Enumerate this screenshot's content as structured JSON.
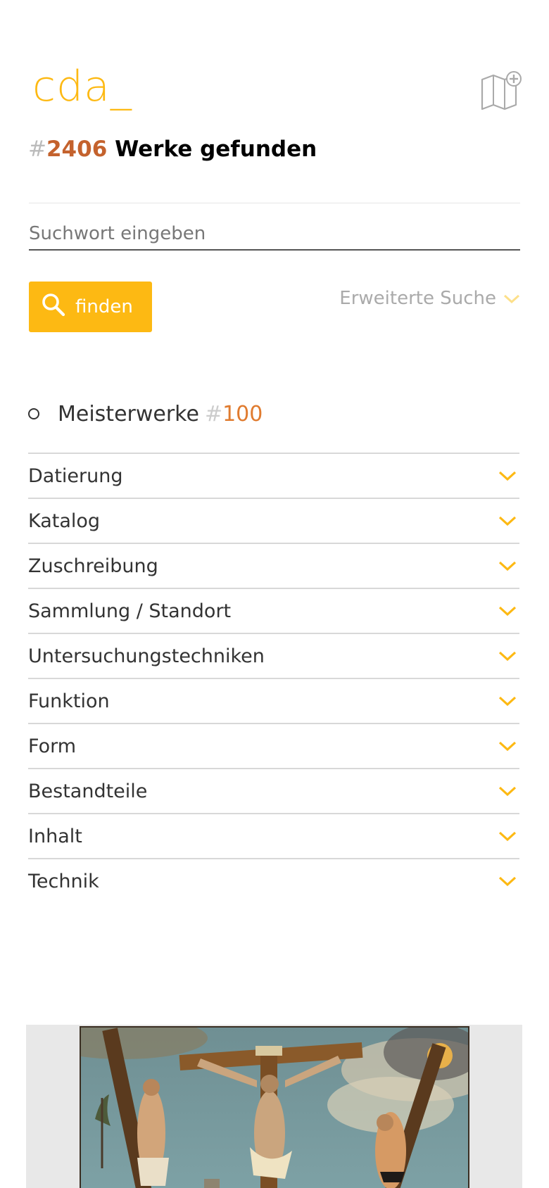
{
  "header": {
    "logo": "cda_",
    "map_icon": "map-add-icon",
    "result_hash": "#",
    "result_count": "2406",
    "result_label": "Werke gefunden"
  },
  "search": {
    "placeholder": "Suchwort eingeben",
    "value": "",
    "button_label": "finden",
    "button_icon": "search-icon",
    "advanced_label": "Erweiterte Suche"
  },
  "masterworks": {
    "label": "Meisterwerke",
    "hash": "#",
    "count": "100"
  },
  "filters": [
    {
      "label": "Datierung"
    },
    {
      "label": "Katalog"
    },
    {
      "label": "Zuschreibung"
    },
    {
      "label": "Sammlung / Standort"
    },
    {
      "label": "Untersuchungstechniken"
    },
    {
      "label": "Funktion"
    },
    {
      "label": "Form"
    },
    {
      "label": "Bestandteile"
    },
    {
      "label": "Inhalt"
    },
    {
      "label": "Technik"
    }
  ],
  "colors": {
    "accent": "#FDB913",
    "count": "#C4622D",
    "masterworks_count": "#E07B2F"
  }
}
